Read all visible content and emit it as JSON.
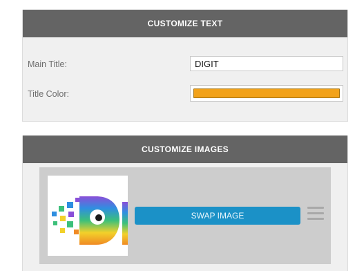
{
  "customize_text": {
    "header": "CUSTOMIZE TEXT",
    "main_title_label": "Main Title:",
    "main_title_value": "DIGIT",
    "title_color_label": "Title Color:",
    "title_color_value": "#f2a21a"
  },
  "customize_images": {
    "header": "CUSTOMIZE IMAGES",
    "items": [
      {
        "thumbnail": "digit-logo-image",
        "swap_label": "SWAP IMAGE"
      }
    ]
  }
}
